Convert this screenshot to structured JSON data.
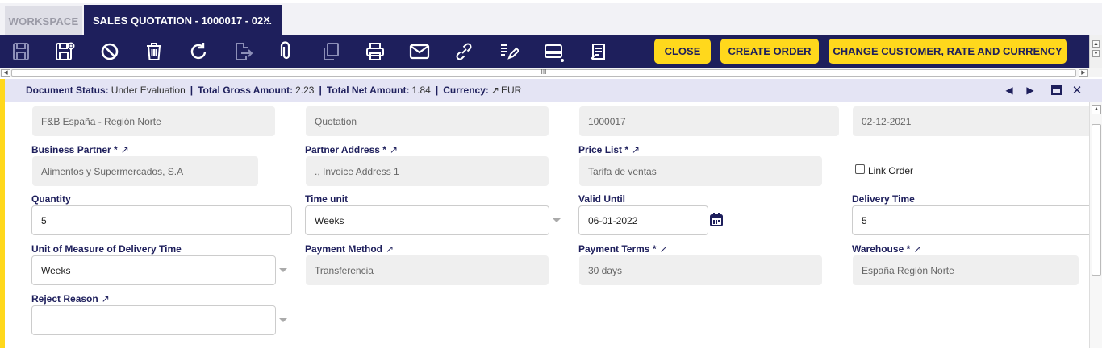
{
  "tabs": {
    "workspace": "WORKSPACE",
    "active": "SALES QUOTATION - 1000017 - 02...",
    "close_glyph": "×"
  },
  "toolbar": {
    "icons": [
      "new-document-icon",
      "save-icon",
      "undo-icon",
      "delete-icon",
      "refresh-icon",
      "export-icon",
      "attachment-icon",
      "copy-record-icon",
      "print-icon",
      "email-icon",
      "link-icon",
      "audit-trail-icon",
      "grid-view-icon",
      "notes-icon"
    ],
    "close_label": "CLOSE",
    "create_order_label": "CREATE ORDER",
    "change_label": "CHANGE CUSTOMER, RATE AND CURRENCY"
  },
  "scroll": {
    "thumb_glyph": "III"
  },
  "status": {
    "doc_status_label": "Document Status:",
    "doc_status_value": "Under Evaluation",
    "gross_label": "Total Gross Amount:",
    "gross_value": "2.23",
    "net_label": "Total Net Amount:",
    "net_value": "1.84",
    "currency_label": "Currency:",
    "currency_value": "EUR",
    "sep": "|"
  },
  "form": {
    "row0": {
      "organization_value": "F&B España - Región Norte",
      "doctype_value": "Quotation",
      "docno_value": "1000017",
      "date_value": "02-12-2021"
    },
    "business_partner": {
      "label": "Business Partner *",
      "value": "Alimentos y Supermercados, S.A"
    },
    "partner_address": {
      "label": "Partner Address *",
      "value": "., Invoice Address 1"
    },
    "price_list": {
      "label": "Price List *",
      "value": "Tarifa de ventas"
    },
    "link_order": {
      "label": "Link Order",
      "checked": false
    },
    "quantity": {
      "label": "Quantity",
      "value": "5"
    },
    "time_unit": {
      "label": "Time unit",
      "value": "Weeks"
    },
    "valid_until": {
      "label": "Valid Until",
      "value": "06-01-2022"
    },
    "delivery_time": {
      "label": "Delivery Time",
      "value": "5"
    },
    "uom_delivery": {
      "label": "Unit of Measure of Delivery Time",
      "value": "Weeks"
    },
    "payment_method": {
      "label": "Payment Method",
      "value": "Transferencia"
    },
    "payment_terms": {
      "label": "Payment Terms *",
      "value": "30 days"
    },
    "warehouse": {
      "label": "Warehouse *",
      "value": "España Región Norte"
    },
    "reject_reason": {
      "label": "Reject Reason",
      "value": ""
    }
  },
  "colors": {
    "navy": "#1e1f5c",
    "yellow": "#ffd81c",
    "status_bg": "#e4e4f4"
  }
}
